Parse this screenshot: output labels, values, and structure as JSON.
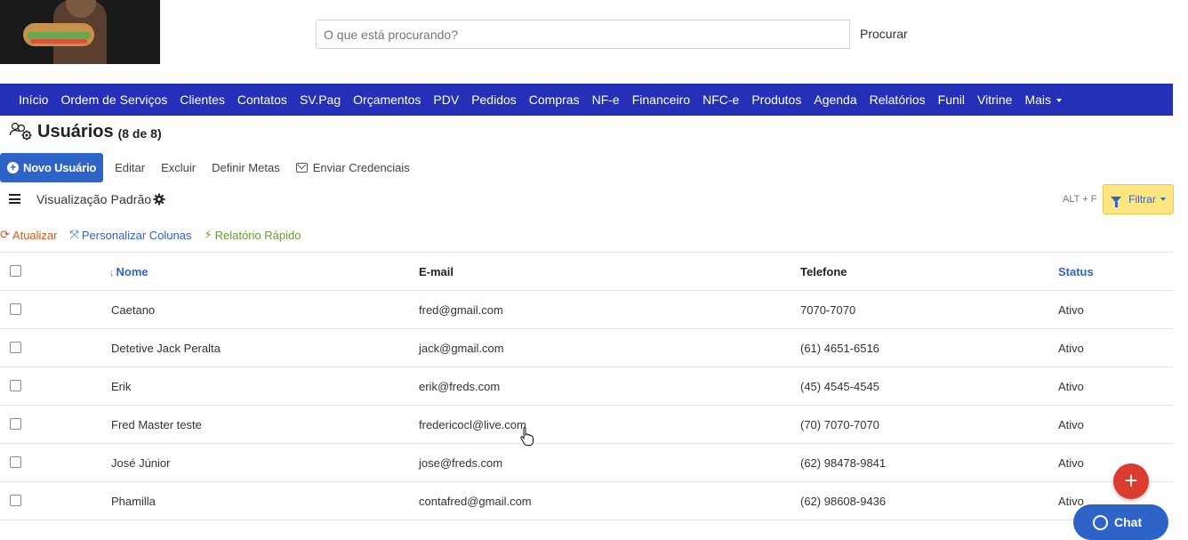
{
  "header": {
    "search_placeholder": "O que está procurando?",
    "search_button": "Procurar"
  },
  "nav": {
    "items": [
      "Início",
      "Ordem de Serviços",
      "Clientes",
      "Contatos",
      "SV.Pag",
      "Orçamentos",
      "PDV",
      "Pedidos",
      "Compras",
      "NF-e",
      "Financeiro",
      "NFC-e",
      "Produtos",
      "Agenda",
      "Relatórios",
      "Funil",
      "Vitrine"
    ],
    "more": "Mais"
  },
  "page": {
    "title": "Usuários",
    "count": "(8 de 8)"
  },
  "toolbar": {
    "new_user": "Novo Usuário",
    "edit": "Editar",
    "delete": "Excluir",
    "goals": "Definir Metas",
    "send_credentials": "Enviar Credenciais"
  },
  "view": {
    "label": "Visualização Padrão",
    "shortcut": "ALT + F",
    "filter": "Filtrar"
  },
  "actions": {
    "refresh": "Atualizar",
    "columns": "Personalizar Colunas",
    "report": "Relatório Rápido"
  },
  "table": {
    "headers": {
      "name": "Nome",
      "email": "E-mail",
      "phone": "Telefone",
      "status": "Status"
    },
    "rows": [
      {
        "name": "Caetano",
        "email": "fred@gmail.com",
        "phone": "7070-7070",
        "status": "Ativo"
      },
      {
        "name": "Detetive Jack Peralta",
        "email": "jack@gmail.com",
        "phone": "(61) 4651-6516",
        "status": "Ativo"
      },
      {
        "name": "Erik",
        "email": "erik@freds.com",
        "phone": "(45) 4545-4545",
        "status": "Ativo"
      },
      {
        "name": "Fred Master teste",
        "email": "fredericocl@live.com",
        "phone": "(70) 7070-7070",
        "status": "Ativo"
      },
      {
        "name": "José Júnior",
        "email": "jose@freds.com",
        "phone": "(62) 98478-9841",
        "status": "Ativo"
      },
      {
        "name": "Phamilla",
        "email": "contafred@gmail.com",
        "phone": "(62) 98608-9436",
        "status": "Ativo"
      }
    ]
  },
  "widgets": {
    "fab": "+",
    "chat": "Chat"
  }
}
